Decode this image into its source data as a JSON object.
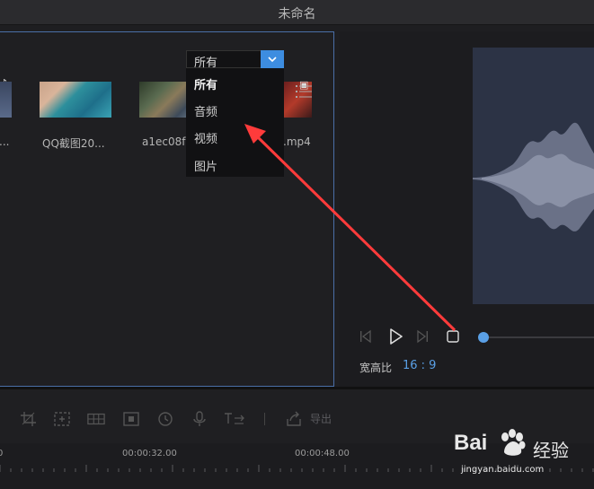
{
  "window": {
    "title": "未命名"
  },
  "media": {
    "items": [
      {
        "label": "..."
      },
      {
        "label": "QQ截图20..."
      },
      {
        "label": "a1ec08f"
      },
      {
        "label": ".mp4"
      }
    ],
    "filter": {
      "selected": "所有",
      "options": [
        "所有",
        "音频",
        "视频",
        "图片"
      ]
    }
  },
  "preview": {
    "aspect_label": "宽高比",
    "aspect_value": "16 : 9"
  },
  "toolbar": {
    "export_label": "导出"
  },
  "timeline": {
    "time_labels": [
      "0",
      "00:00:32.00",
      "00:00:48.00"
    ]
  },
  "watermark": {
    "brand": "Bai",
    "brand_cn": "经验",
    "url": "jingyan.baidu.com"
  },
  "colors": {
    "accent": "#3d8de0",
    "selection_border": "#4a6fa8",
    "annotation_arrow": "#ff3b3b"
  }
}
